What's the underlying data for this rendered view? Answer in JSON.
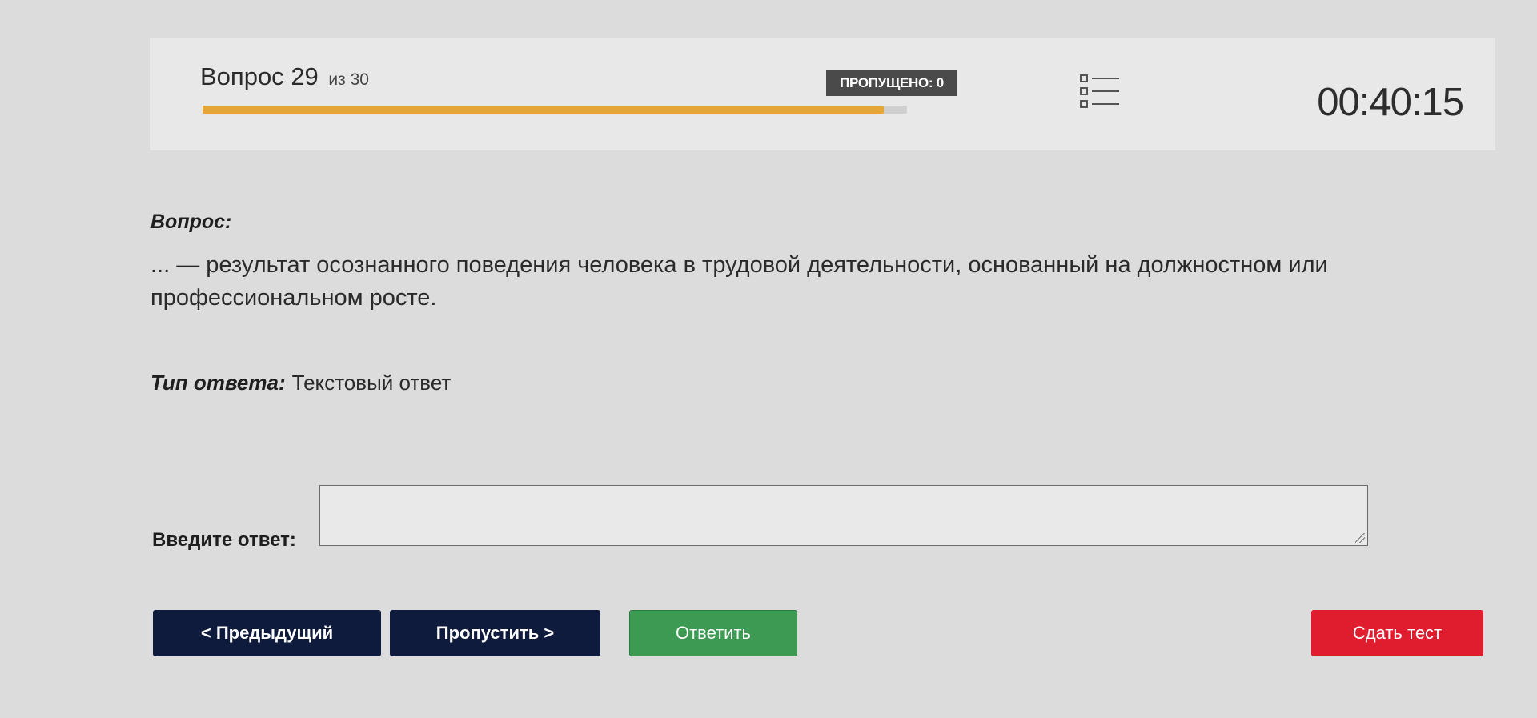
{
  "header": {
    "question_label": "Вопрос",
    "question_number": "29",
    "question_of": "из 30",
    "progress": 0.967,
    "skipped_label": "ПРОПУЩЕНО: 0",
    "list_icon": "list-icon",
    "timer": "00:40:15",
    "accent_color": "#e6a635"
  },
  "question": {
    "label": "Вопрос:",
    "text": "... — результат осознанного поведения человека в трудовой деятельности, основанный на должностном или профессиональном росте."
  },
  "answer_type": {
    "label": "Тип ответа:",
    "value": "Текстовый ответ"
  },
  "answer": {
    "label": "Введите ответ:",
    "value": "",
    "placeholder": ""
  },
  "buttons": {
    "prev": "< Предыдущий",
    "skip": "Пропустить >",
    "answer": "Ответить",
    "submit": "Сдать тест"
  },
  "colors": {
    "nav_button": "#0f1b3d",
    "answer_button": "#3d9a52",
    "submit_button": "#e01d2f"
  }
}
